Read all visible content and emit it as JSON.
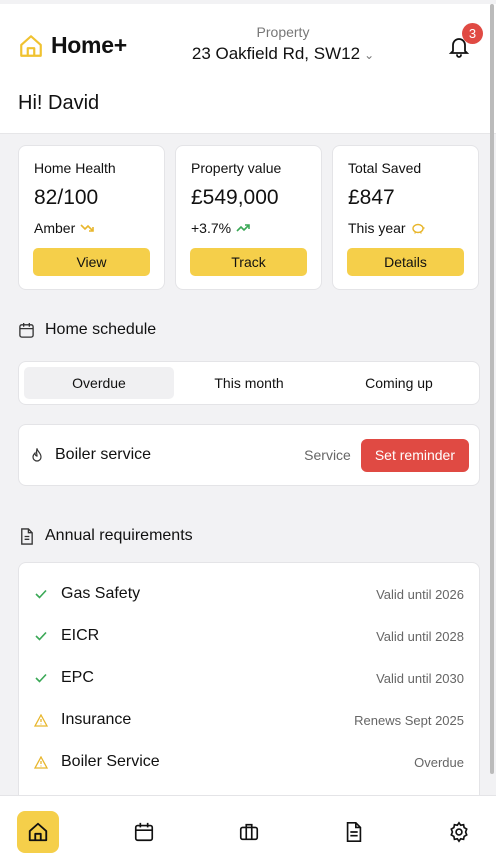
{
  "app": {
    "name": "Home+"
  },
  "property": {
    "label": "Property",
    "address": "23 Oakfield Rd, SW12",
    "dropdown_icon": "chevron-down-icon"
  },
  "notifications": {
    "count": "3"
  },
  "greeting": "Hi! David",
  "cards": [
    {
      "title": "Home Health",
      "value": "82/100",
      "sub": "Amber",
      "sub_icon": "trend-down-icon",
      "button": "View"
    },
    {
      "title": "Property value",
      "value": "£549,000",
      "sub": "+3.7%",
      "sub_icon": "trend-up-icon",
      "button": "Track"
    },
    {
      "title": "Total Saved",
      "value": "£847",
      "sub": "This year",
      "sub_icon": "piggy-bank-icon",
      "button": "Details"
    }
  ],
  "schedule": {
    "title": "Home schedule",
    "tabs": [
      "Overdue",
      "This month",
      "Coming up"
    ],
    "active_tab": "Overdue",
    "tasks": [
      {
        "name": "Boiler service",
        "type": "Service",
        "action": "Set reminder"
      }
    ]
  },
  "requirements": {
    "title": "Annual requirements",
    "items": [
      {
        "name": "Gas Safety",
        "status": "Valid until 2026",
        "state": "ok"
      },
      {
        "name": "EICR",
        "status": "Valid until 2028",
        "state": "ok"
      },
      {
        "name": "EPC",
        "status": "Valid until 2030",
        "state": "ok"
      },
      {
        "name": "Insurance",
        "status": "Renews Sept 2025",
        "state": "warning"
      },
      {
        "name": "Boiler Service",
        "status": "Overdue",
        "state": "warning"
      }
    ]
  },
  "nav": [
    "home-icon",
    "calendar-icon",
    "briefcase-icon",
    "document-icon",
    "settings-icon"
  ],
  "colors": {
    "accent": "#f5cf4a",
    "danger": "#e04a43",
    "ok": "#3aa856",
    "warning": "#e8b62c"
  }
}
